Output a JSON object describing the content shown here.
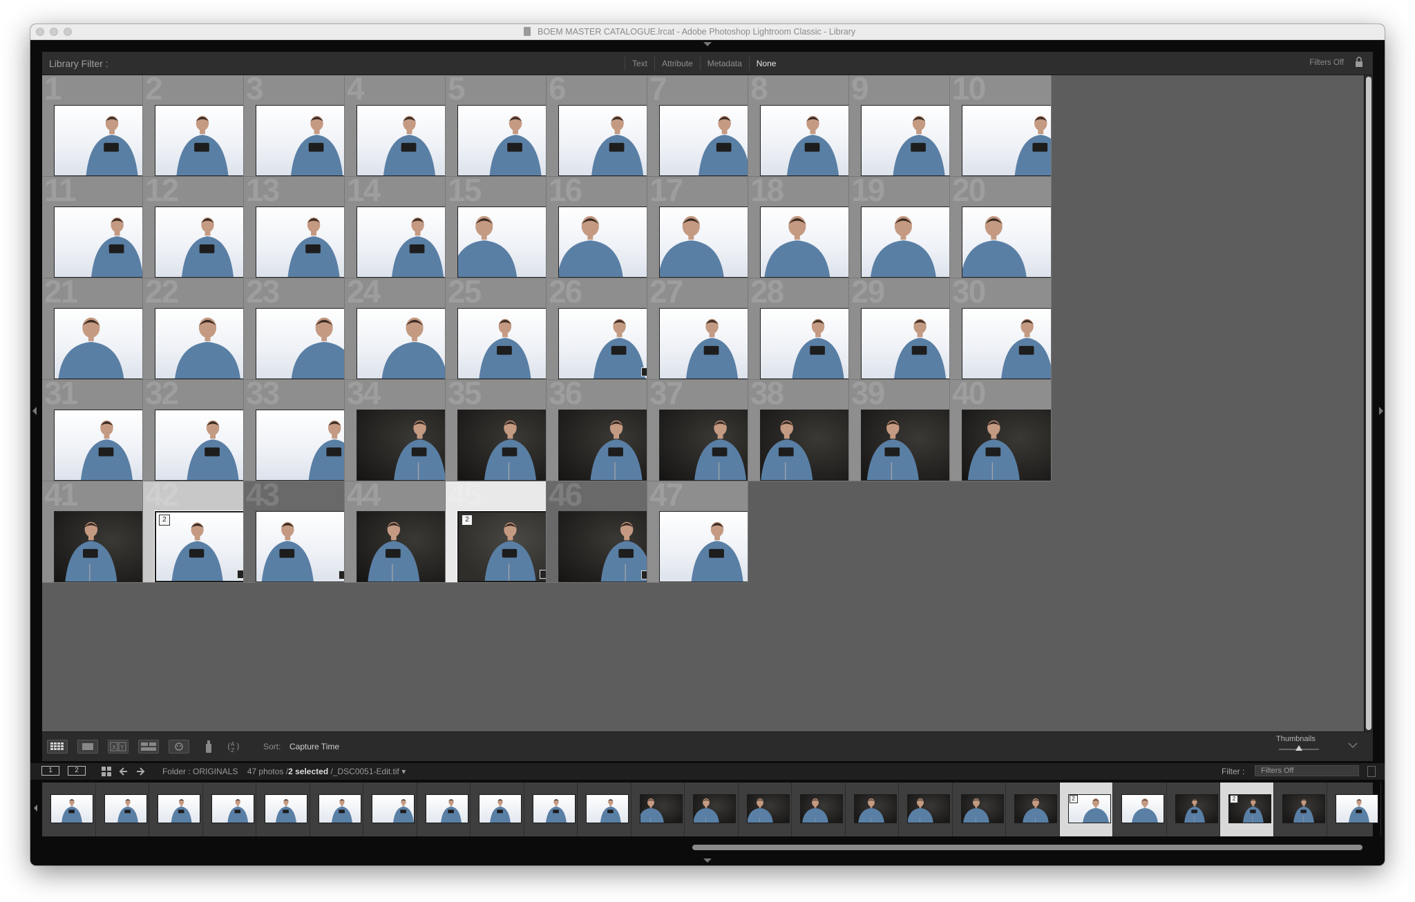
{
  "window": {
    "title": "BOEM MASTER CATALOGUE.lrcat - Adobe Photoshop Lightroom Classic - Library"
  },
  "filter_bar": {
    "label": "Library Filter :",
    "tabs": [
      "Text",
      "Attribute",
      "Metadata",
      "None"
    ],
    "active_tab": "None",
    "preset": "Filters Off"
  },
  "grid": {
    "cells": [
      {
        "num": "1",
        "bg": "light"
      },
      {
        "num": "2",
        "bg": "light"
      },
      {
        "num": "3",
        "bg": "light"
      },
      {
        "num": "4",
        "bg": "light"
      },
      {
        "num": "5",
        "bg": "light"
      },
      {
        "num": "6",
        "bg": "light"
      },
      {
        "num": "7",
        "bg": "light"
      },
      {
        "num": "8",
        "bg": "light"
      },
      {
        "num": "9",
        "bg": "light"
      },
      {
        "num": "10",
        "bg": "light"
      },
      {
        "num": "11",
        "bg": "light"
      },
      {
        "num": "12",
        "bg": "light"
      },
      {
        "num": "13",
        "bg": "light"
      },
      {
        "num": "14",
        "bg": "light"
      },
      {
        "num": "15",
        "bg": "light"
      },
      {
        "num": "16",
        "bg": "light"
      },
      {
        "num": "17",
        "bg": "light"
      },
      {
        "num": "18",
        "bg": "light"
      },
      {
        "num": "19",
        "bg": "light"
      },
      {
        "num": "20",
        "bg": "light"
      },
      {
        "num": "21",
        "bg": "light"
      },
      {
        "num": "22",
        "bg": "light"
      },
      {
        "num": "23",
        "bg": "light"
      },
      {
        "num": "24",
        "bg": "light"
      },
      {
        "num": "25",
        "bg": "light"
      },
      {
        "num": "26",
        "bg": "light",
        "badges": true
      },
      {
        "num": "27",
        "bg": "light"
      },
      {
        "num": "28",
        "bg": "light"
      },
      {
        "num": "29",
        "bg": "light"
      },
      {
        "num": "30",
        "bg": "light"
      },
      {
        "num": "31",
        "bg": "light"
      },
      {
        "num": "32",
        "bg": "light"
      },
      {
        "num": "33",
        "bg": "light"
      },
      {
        "num": "34",
        "bg": "dark"
      },
      {
        "num": "35",
        "bg": "dark"
      },
      {
        "num": "36",
        "bg": "dark"
      },
      {
        "num": "37",
        "bg": "dark"
      },
      {
        "num": "38",
        "bg": "dark"
      },
      {
        "num": "39",
        "bg": "dark"
      },
      {
        "num": "40",
        "bg": "dark"
      },
      {
        "num": "41",
        "bg": "dark"
      },
      {
        "num": "42",
        "bg": "light",
        "stack": "2",
        "state": "selected",
        "badges": true
      },
      {
        "num": "43",
        "bg": "light",
        "state": "darkcell",
        "badges": true
      },
      {
        "num": "44",
        "bg": "dark"
      },
      {
        "num": "45",
        "bg": "mid",
        "stack": "2",
        "state": "active",
        "badges": true
      },
      {
        "num": "46",
        "bg": "dark",
        "state": "darkcell",
        "badges": true
      },
      {
        "num": "47",
        "bg": "light"
      }
    ]
  },
  "toolbar": {
    "sort_label": "Sort:",
    "sort_value": "Capture Time",
    "thumbnails_label": "Thumbnails",
    "thumbnail_size": 0.5
  },
  "filmstrip_bar": {
    "screen1": "1",
    "screen2": "2",
    "folder_prefix": "Folder : ORIGINALS",
    "photo_count": "47 photos /",
    "selected": "2 selected",
    "file": " /_DSC0051-Edit.tif ▾",
    "filter_label": "Filter :",
    "filter_value": "Filters Off"
  },
  "filmstrip": {
    "cells": [
      {
        "bg": "light"
      },
      {
        "bg": "light"
      },
      {
        "bg": "light"
      },
      {
        "bg": "light",
        "badges": true
      },
      {
        "bg": "light"
      },
      {
        "bg": "light"
      },
      {
        "bg": "light"
      },
      {
        "bg": "light"
      },
      {
        "bg": "light"
      },
      {
        "bg": "light"
      },
      {
        "bg": "light"
      },
      {
        "bg": "dark"
      },
      {
        "bg": "dark"
      },
      {
        "bg": "dark"
      },
      {
        "bg": "dark"
      },
      {
        "bg": "dark"
      },
      {
        "bg": "dark"
      },
      {
        "bg": "dark"
      },
      {
        "bg": "dark"
      },
      {
        "bg": "light",
        "stack": "2",
        "state": "lit",
        "badges": true
      },
      {
        "bg": "light",
        "badges": true
      },
      {
        "bg": "dark"
      },
      {
        "bg": "mid",
        "stack": "2",
        "state": "lit"
      },
      {
        "bg": "dark",
        "badges": true
      },
      {
        "bg": "light"
      }
    ]
  },
  "colors": {
    "cell_light": "#8e8e8e",
    "cell_dark": "#696969",
    "cell_selected": "#c8c8c8",
    "cell_active": "#e9e9e9",
    "shirt_blue": "#5a7fa5",
    "skin": "#c49a82"
  }
}
